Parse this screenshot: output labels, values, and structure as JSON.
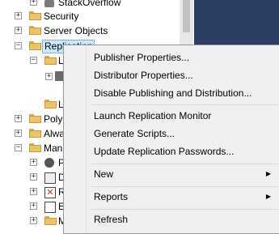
{
  "tree": {
    "db_item": "StackOverflow",
    "security": "Security",
    "server_objects": "Server Objects",
    "replication": "Replication",
    "sub1": "L",
    "sub2": "L",
    "polybase": "Polyl",
    "always": "Alwa",
    "management": "Man",
    "mgmt_children": [
      "P",
      "D",
      "R",
      "E",
      "M"
    ]
  },
  "menu": {
    "items": [
      {
        "label": "Publisher Properties..."
      },
      {
        "label": "Distributor Properties..."
      },
      {
        "label": "Disable Publishing and Distribution..."
      },
      {
        "label": "Launch Replication Monitor"
      },
      {
        "label": "Generate Scripts..."
      },
      {
        "label": "Update Replication Passwords..."
      },
      {
        "label": "New"
      },
      {
        "label": "Reports"
      },
      {
        "label": "Refresh"
      }
    ],
    "submenu_arrow": "▶"
  },
  "colors": {
    "selection": "#cce8ff",
    "menu_bg": "#f0f0f0",
    "folder": "#e9c46a",
    "panel": "#2c3e63"
  }
}
